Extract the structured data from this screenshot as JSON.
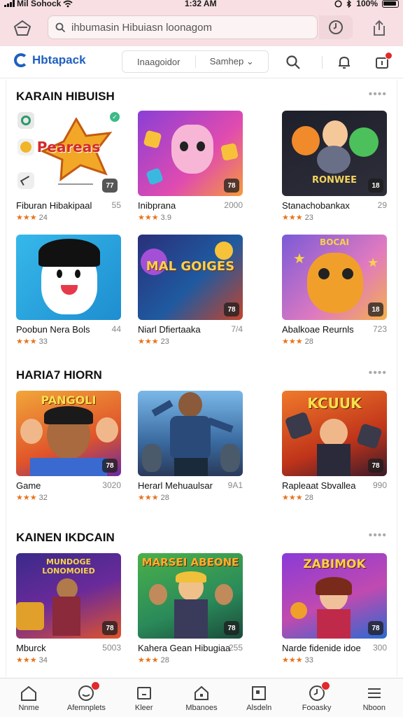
{
  "status": {
    "carrier": "Mil Sohock",
    "time": "1:32 AM",
    "battery": "100%"
  },
  "browser": {
    "url": "ihbumasin Hibuiasn loonagom"
  },
  "app": {
    "logo": "Hbtapack",
    "seg_left": "Inaagoidor",
    "seg_right": "Samhep"
  },
  "colors": {
    "brand": "#1f5fbf",
    "star": "#e8731b",
    "badge": "#e12a2a",
    "chrome": "#f7dfe3"
  },
  "sections": [
    {
      "title": "KARAIN HIBUISH",
      "items": [
        {
          "name": "Fiburan Hibakipaal",
          "count": "55",
          "stars": "★★★",
          "rating": "24",
          "corner": "77",
          "art": "Peareas"
        },
        {
          "name": "Inibprana",
          "count": "2000",
          "stars": "★★★",
          "rating": "3.9",
          "corner": "78",
          "art": ""
        },
        {
          "name": "Stanachobankax",
          "count": "29",
          "stars": "★★★",
          "rating": "23",
          "corner": "18",
          "art": "RONWEE"
        },
        {
          "name": "Poobun Nera Bols",
          "count": "44",
          "stars": "★★★",
          "rating": "33",
          "corner": "",
          "art": ""
        },
        {
          "name": "Niarl Dfiertaaka",
          "count": "7/4",
          "stars": "★★★",
          "rating": "23",
          "corner": "78",
          "art": "MAL GOIGES"
        },
        {
          "name": "Abalkoae Reurnls",
          "count": "723",
          "stars": "★★★",
          "rating": "28",
          "corner": "18",
          "art": "BOCAI"
        }
      ]
    },
    {
      "title": "HARIA7 HIORN",
      "items": [
        {
          "name": "Game",
          "count": "3020",
          "stars": "★★★",
          "rating": "32",
          "corner": "78",
          "art": "PANGOLI"
        },
        {
          "name": "Herarl Mehuaulsar",
          "count": "9A1",
          "stars": "★★★",
          "rating": "28",
          "corner": "",
          "art": ""
        },
        {
          "name": "Rapleaat Sbvallea",
          "count": "990",
          "stars": "★★★",
          "rating": "28",
          "corner": "78",
          "art": "KCUUK"
        }
      ]
    },
    {
      "title": "KAINEN IKDCAIN",
      "items": [
        {
          "name": "Mburck",
          "count": "5003",
          "stars": "★★★",
          "rating": "34",
          "corner": "78",
          "art": "MUNDOGE LONOMOIED"
        },
        {
          "name": "Kahera Gean Hibugiaa",
          "count": "255",
          "stars": "★★★",
          "rating": "28",
          "corner": "78",
          "art": "MARSEI ABEONE"
        },
        {
          "name": "Narde fidenide idoe",
          "count": "300",
          "stars": "★★★",
          "rating": "33",
          "corner": "78",
          "art": "ZABIMOK"
        }
      ]
    }
  ],
  "bottom_nav": [
    {
      "label": "Nnme",
      "icon": "home-icon"
    },
    {
      "label": "Afemnplets",
      "icon": "smiley-icon",
      "badge": true
    },
    {
      "label": "Kleer",
      "icon": "tablet-icon"
    },
    {
      "label": "Mbanoes",
      "icon": "house-icon"
    },
    {
      "label": "Alsdeln",
      "icon": "square-icon"
    },
    {
      "label": "Fooasky",
      "icon": "clock-icon",
      "badge": true
    },
    {
      "label": "Nboon",
      "icon": "menu-icon"
    }
  ]
}
